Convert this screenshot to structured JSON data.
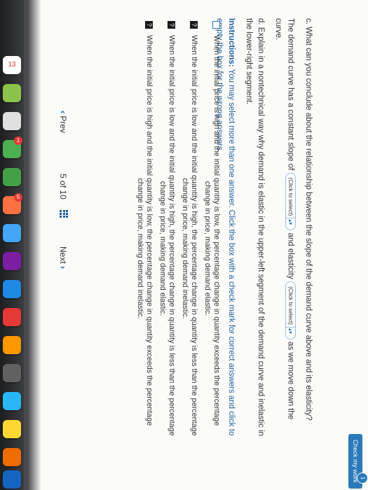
{
  "question": {
    "c_prompt": "c. What can you conclude about the relationship between the slope of the demand curve above and its elasticity?",
    "c_answer_prefix": "The demand curve has a constant slope of",
    "c_select1": "(Click to select)",
    "c_answer_mid": "and elasticity",
    "c_select2": "(Click to select)",
    "c_answer_suffix": "as we move down the",
    "c_answer_end": "curve.",
    "d_prompt_line1": "d. Explain in a nontechnical way why demand is elastic in the upper-left segment of the demand curve and inelastic in",
    "d_prompt_line2": "the lower-right segment.",
    "instructions_label": "Instructions:",
    "instructions_line1": "You may select more than one answer. Click the box with a check mark for correct answers and click to",
    "instructions_line2": "empty the box for the wrong answers."
  },
  "answers": [
    {
      "state": "empty",
      "line1": "When the initial price is high and the initial quantity is low, the percentage change in quantity exceeds the percentage",
      "line2": "change in price, making demand elastic."
    },
    {
      "state": "unknown",
      "line1": "When the initial price is low and the initial quantity is high, the percentage change in quantity is less than the percentage",
      "line2": "change in price, making demand inelastic."
    },
    {
      "state": "unknown",
      "line1": "When the initial price is low and the initial quantity is high, the percentage change in quantity is less than the percentage",
      "line2": "change in price, making demand elastic."
    },
    {
      "state": "unknown",
      "line1": "When the initial price is high and the initial quantity is low, the percentage change in quantity exceeds the percentage",
      "line2": "change in price, making demand inelastic."
    }
  ],
  "toolbar": {
    "check_label": "Check my work",
    "check_badge": "1"
  },
  "nav": {
    "prev_label": "Prev",
    "page_current": "5",
    "page_of": "of",
    "page_total": "10",
    "next_label": "Next"
  },
  "dock": {
    "calendar_date": "13",
    "badge1": "1",
    "badge2": "5"
  }
}
